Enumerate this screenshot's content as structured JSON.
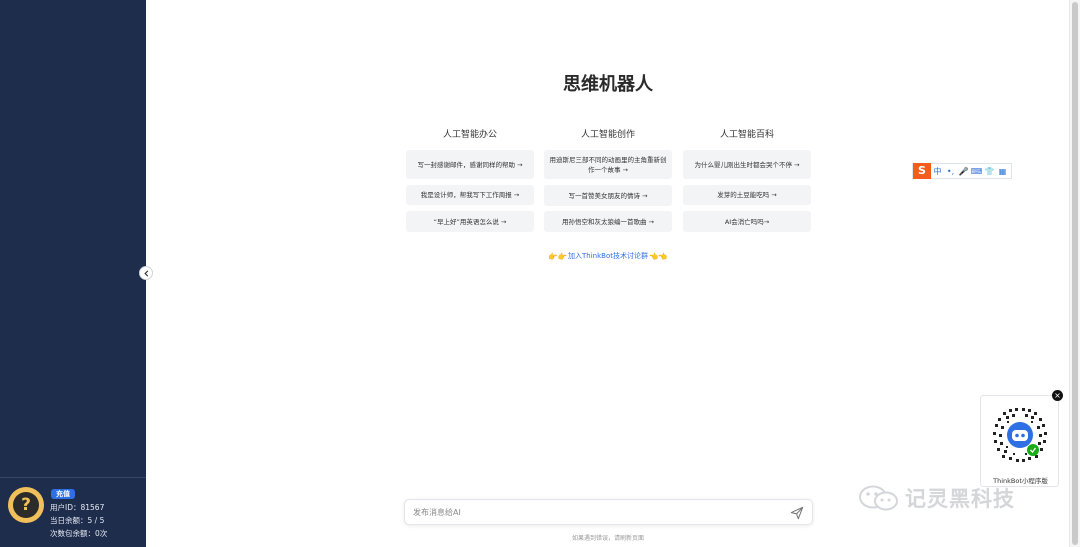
{
  "app": {
    "title": "思维机器人"
  },
  "sidebar": {
    "recharge_label": "充值",
    "user_id_line": "用户ID：81567",
    "daily_balance_line": "当日余额：5 / 5",
    "pack_balance_line": "次数包余额：0次",
    "avatar_glyph": "?",
    "collapse_icon": "chevron-left-icon"
  },
  "columns": [
    {
      "title": "人工智能办公",
      "prompts": [
        "写一封感谢邮件，感谢同样的帮助 →",
        "我是设计师，帮我写下工作周报 →",
        "“早上好”用英语怎么说 →"
      ]
    },
    {
      "title": "人工智能创作",
      "prompts": [
        "用迪斯尼三部不同的动画里的主角重新创作一个故事 →",
        "写一首赞美女朋友的情诗 →",
        "用孙悟空和灰太狼编一首歌曲 →"
      ]
    },
    {
      "title": "人工智能百科",
      "prompts": [
        "为什么婴儿刚出生时都会哭个不停 →",
        "发芽的土豆能吃吗 →",
        "AI会消亡吗吗→"
      ]
    }
  ],
  "join_group": {
    "label": "加入ThinkBot技术讨论群",
    "left_hands": "👉👉",
    "right_hands": "👈👈"
  },
  "chat": {
    "placeholder": "发布消息给AI",
    "footer_hint": "如果遇到错误，请刷新页面",
    "send_icon": "send-icon"
  },
  "ime_toolbar": {
    "logo": "S",
    "items": [
      "中",
      "•,",
      "🎤",
      "⌨",
      "👕",
      "▦"
    ]
  },
  "qr_popup": {
    "label": "ThinkBot小程序版",
    "close_glyph": "×"
  },
  "watermark": {
    "text": "记灵黑科技"
  },
  "colors": {
    "sidebar_bg": "#1f2d4d",
    "accent": "#2f6fe4",
    "card_bg": "#f3f4f6",
    "ime_orange": "#f25c1c"
  }
}
